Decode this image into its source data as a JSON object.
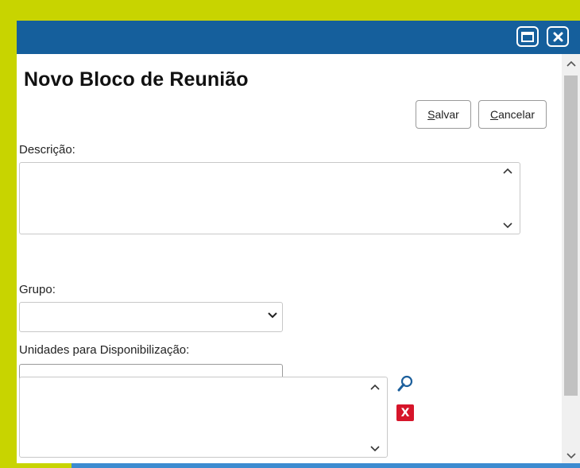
{
  "dialog": {
    "title": "Novo Bloco de Reunião",
    "titlebar_color": "#155f9c",
    "maximize_icon": "window-maximize-icon",
    "close_icon": "close-icon"
  },
  "toolbar": {
    "save_label_prefix": "S",
    "save_label_rest": "alvar",
    "cancel_label_prefix": "C",
    "cancel_label_rest": "ancelar"
  },
  "form": {
    "descricao_label": "Descrição:",
    "descricao_value": "",
    "grupo_label": "Grupo:",
    "grupo_selected": "",
    "unidades_label": "Unidades para Disponibilização:",
    "unidades_input_value": "",
    "unidades_list": [],
    "search_icon": "search-icon",
    "remove_icon": "remove-icon",
    "remove_glyph": "X",
    "remove_color": "#d6152a"
  }
}
